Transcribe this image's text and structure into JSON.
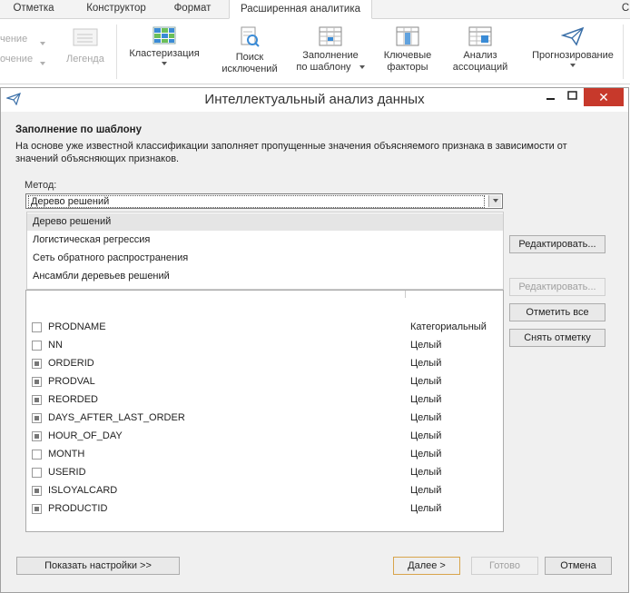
{
  "tabs": [
    {
      "label": "Отметка"
    },
    {
      "label": "Конструктор"
    },
    {
      "label": "Формат"
    },
    {
      "label": "Расширенная аналитика"
    },
    {
      "label": "С"
    }
  ],
  "ribbon": {
    "left_items": [
      "чение",
      "очение",
      "Легенда"
    ],
    "buttons": [
      {
        "line1": "Кластеризация",
        "line2": ""
      },
      {
        "line1": "Поиск",
        "line2": "исключений"
      },
      {
        "line1": "Заполнение",
        "line2": "по шаблону"
      },
      {
        "line1": "Ключевые",
        "line2": "факторы"
      },
      {
        "line1": "Анализ",
        "line2": "ассоциаций"
      },
      {
        "line1": "Прогнозирование",
        "line2": ""
      }
    ]
  },
  "dialog": {
    "title": "Интеллектуальный анализ данных",
    "close_symbol": "✕",
    "heading": "Заполнение по шаблону",
    "description": "На основе уже известной классификации заполняет пропущенные значения объясняемого признака в зависимости от значений объясняющих признаков.",
    "method_label": "Метод:",
    "method_selected": "Дерево решений",
    "method_options": [
      "Дерево решений",
      "Логистическая регрессия",
      "Сеть обратного распространения",
      "Ансамбли деревьев решений"
    ],
    "fields": [
      {
        "name": "PRODNAME",
        "type": "Категориальный",
        "checked": false
      },
      {
        "name": "NN",
        "type": "Целый",
        "checked": false
      },
      {
        "name": "ORDERID",
        "type": "Целый",
        "checked": true
      },
      {
        "name": "PRODVAL",
        "type": "Целый",
        "checked": true
      },
      {
        "name": "REORDED",
        "type": "Целый",
        "checked": true
      },
      {
        "name": "DAYS_AFTER_LAST_ORDER",
        "type": "Целый",
        "checked": true
      },
      {
        "name": "HOUR_OF_DAY",
        "type": "Целый",
        "checked": true
      },
      {
        "name": "MONTH",
        "type": "Целый",
        "checked": false
      },
      {
        "name": "USERID",
        "type": "Целый",
        "checked": false
      },
      {
        "name": "ISLOYALCARD",
        "type": "Целый",
        "checked": true
      },
      {
        "name": "PRODUCTID",
        "type": "Целый",
        "checked": true
      }
    ],
    "side_buttons": {
      "edit1": "Редактировать...",
      "edit2": "Редактировать...",
      "check_all": "Отметить все",
      "uncheck": "Снять отметку"
    },
    "footer": {
      "show_settings": "Показать настройки >>",
      "next": "Далее >",
      "done": "Готово",
      "cancel": "Отмена"
    }
  },
  "colors": {
    "close": "#c7392b",
    "accent": "#d8a44b"
  }
}
